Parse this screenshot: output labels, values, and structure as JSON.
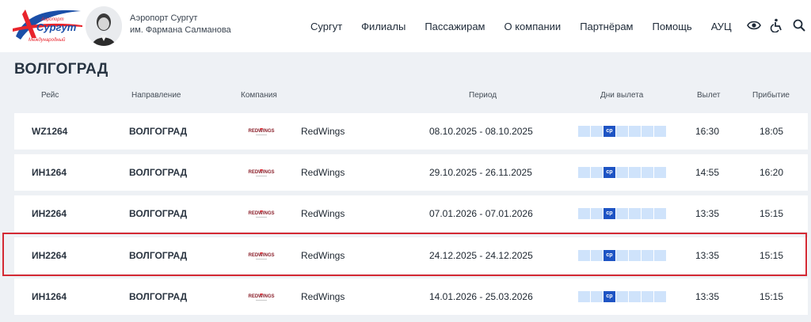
{
  "header": {
    "logo_text": [
      "Аэропорт",
      "Сургут",
      "Международный"
    ],
    "airport_name_line1": "Аэропорт Сургут",
    "airport_name_line2": "им. Фармана Салманова",
    "nav": [
      "Сургут",
      "Филиалы",
      "Пассажирам",
      "О компании",
      "Партнёрам",
      "Помощь",
      "АУЦ"
    ],
    "tools": [
      "eye-icon",
      "accessibility-icon",
      "search-icon"
    ]
  },
  "page_title": "ВОЛГОГРАД",
  "columns": {
    "flight": "Рейс",
    "destination": "Направление",
    "company": "Компания",
    "period": "Период",
    "days": "Дни вылета",
    "departure": "Вылет",
    "arrival": "Прибытие"
  },
  "airline_logo_text": "REDWINGS",
  "rows": [
    {
      "flight": "WZ1264",
      "destination": "ВОЛГОГРАД",
      "airline": "RedWings",
      "period": "08.10.2025 - 08.10.2025",
      "day_label": "ср",
      "active_day_index": 2,
      "departure": "16:30",
      "arrival": "18:05"
    },
    {
      "flight": "ИН1264",
      "destination": "ВОЛГОГРАД",
      "airline": "RedWings",
      "period": "29.10.2025 - 26.11.2025",
      "day_label": "ср",
      "active_day_index": 2,
      "departure": "14:55",
      "arrival": "16:20"
    },
    {
      "flight": "ИН2264",
      "destination": "ВОЛГОГРАД",
      "airline": "RedWings",
      "period": "07.01.2026 - 07.01.2026",
      "day_label": "ср",
      "active_day_index": 2,
      "departure": "13:35",
      "arrival": "15:15"
    },
    {
      "flight": "ИН2264",
      "destination": "ВОЛГОГРАД",
      "airline": "RedWings",
      "period": "24.12.2025 - 24.12.2025",
      "day_label": "ср",
      "active_day_index": 2,
      "departure": "13:35",
      "arrival": "15:15"
    },
    {
      "flight": "ИН1264",
      "destination": "ВОЛГОГРАД",
      "airline": "RedWings",
      "period": "14.01.2026 - 25.03.2026",
      "day_label": "ср",
      "active_day_index": 2,
      "departure": "13:35",
      "arrival": "15:15"
    }
  ],
  "highlighted_row_index": 3,
  "colors": {
    "highlight": "#d42a34",
    "day_active": "#1e54c4",
    "day_inactive": "#cfe3fb",
    "logo_red": "#e8242c",
    "logo_blue": "#1b4fa8"
  }
}
